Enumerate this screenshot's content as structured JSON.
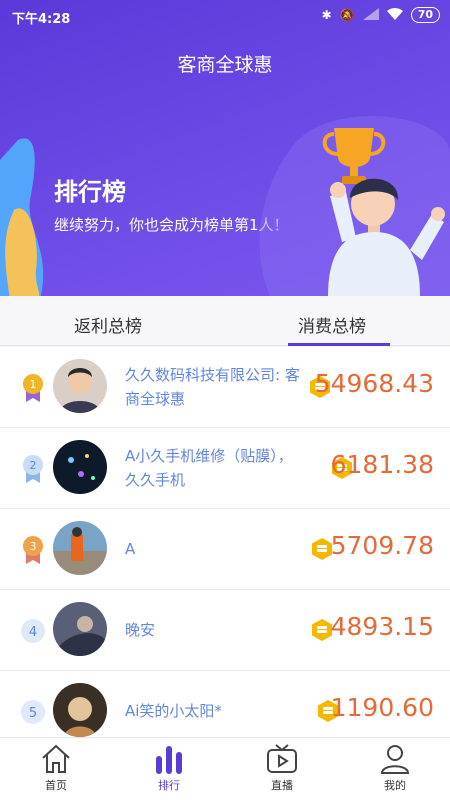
{
  "status": {
    "time": "下午4:28",
    "battery": "70"
  },
  "header": {
    "title": "客商全球惠"
  },
  "banner": {
    "title": "排行榜",
    "subtitle": "继续努力，你也会成为榜单第1人！"
  },
  "tabs": [
    {
      "label": "返利总榜",
      "active": false
    },
    {
      "label": "消费总榜",
      "active": true
    }
  ],
  "ranking": [
    {
      "rank": "1",
      "name": "久久数码科技有限公司: 客商全球惠",
      "amount": "54968.43",
      "medal_color": "#f0b429"
    },
    {
      "rank": "2",
      "name": "A小久手机维修（贴膜），久久手机",
      "amount": "6181.38",
      "medal_color": "#8fb4e8"
    },
    {
      "rank": "3",
      "name": "A",
      "amount": "5709.78",
      "medal_color": "#f0a24a"
    },
    {
      "rank": "4",
      "name": "晚安",
      "amount": "4893.15"
    },
    {
      "rank": "5",
      "name": "Ai笑的小太阳*",
      "amount": "1190.60"
    }
  ],
  "nav": [
    {
      "label": "首页",
      "icon": "home-icon",
      "active": false
    },
    {
      "label": "排行",
      "icon": "ranking-icon",
      "active": true
    },
    {
      "label": "直播",
      "icon": "live-tv-icon",
      "active": false
    },
    {
      "label": "我的",
      "icon": "profile-icon",
      "active": false
    }
  ],
  "colors": {
    "primary": "#5b3bd6",
    "amount": "#e56a38",
    "name": "#5f86e0",
    "coin": "#f5b800"
  }
}
